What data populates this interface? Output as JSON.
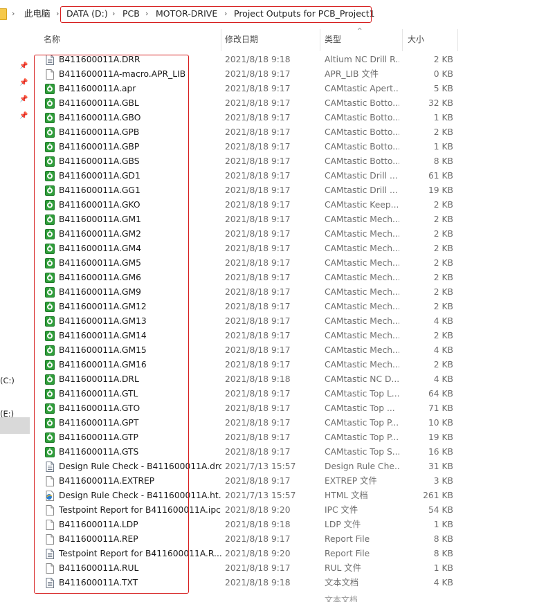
{
  "breadcrumb": {
    "items": [
      "此电脑",
      "DATA (D:)",
      "PCB",
      "MOTOR-DRIVE",
      "Project Outputs for PCB_Project1"
    ]
  },
  "left_pane": {
    "drives": [
      "(C:)",
      "(E:)"
    ]
  },
  "columns": {
    "name": "名称",
    "date": "修改日期",
    "type": "类型",
    "size": "大小"
  },
  "files": [
    {
      "name": "B411600011A.DRR",
      "date": "2021/8/18 9:18",
      "type": "Altium NC Drill R...",
      "size": "2 KB",
      "icon": "text-file-icon"
    },
    {
      "name": "B411600011A-macro.APR_LIB",
      "date": "2021/8/18 9:17",
      "type": "APR_LIB 文件",
      "size": "0 KB",
      "icon": "blank-file-icon"
    },
    {
      "name": "B411600011A.apr",
      "date": "2021/8/18 9:17",
      "type": "CAMtastic Apert...",
      "size": "5 KB",
      "icon": "camtastic-icon"
    },
    {
      "name": "B411600011A.GBL",
      "date": "2021/8/18 9:17",
      "type": "CAMtastic Botto...",
      "size": "32 KB",
      "icon": "camtastic-icon"
    },
    {
      "name": "B411600011A.GBO",
      "date": "2021/8/18 9:17",
      "type": "CAMtastic Botto...",
      "size": "1 KB",
      "icon": "camtastic-icon"
    },
    {
      "name": "B411600011A.GPB",
      "date": "2021/8/18 9:17",
      "type": "CAMtastic Botto...",
      "size": "2 KB",
      "icon": "camtastic-icon"
    },
    {
      "name": "B411600011A.GBP",
      "date": "2021/8/18 9:17",
      "type": "CAMtastic Botto...",
      "size": "1 KB",
      "icon": "camtastic-icon"
    },
    {
      "name": "B411600011A.GBS",
      "date": "2021/8/18 9:17",
      "type": "CAMtastic Botto...",
      "size": "8 KB",
      "icon": "camtastic-icon"
    },
    {
      "name": "B411600011A.GD1",
      "date": "2021/8/18 9:17",
      "type": "CAMtastic Drill ...",
      "size": "61 KB",
      "icon": "camtastic-icon"
    },
    {
      "name": "B411600011A.GG1",
      "date": "2021/8/18 9:17",
      "type": "CAMtastic Drill ...",
      "size": "19 KB",
      "icon": "camtastic-icon"
    },
    {
      "name": "B411600011A.GKO",
      "date": "2021/8/18 9:17",
      "type": "CAMtastic Keep...",
      "size": "2 KB",
      "icon": "camtastic-icon"
    },
    {
      "name": "B411600011A.GM1",
      "date": "2021/8/18 9:17",
      "type": "CAMtastic Mech...",
      "size": "2 KB",
      "icon": "camtastic-icon"
    },
    {
      "name": "B411600011A.GM2",
      "date": "2021/8/18 9:17",
      "type": "CAMtastic Mech...",
      "size": "2 KB",
      "icon": "camtastic-icon"
    },
    {
      "name": "B411600011A.GM4",
      "date": "2021/8/18 9:17",
      "type": "CAMtastic Mech...",
      "size": "2 KB",
      "icon": "camtastic-icon"
    },
    {
      "name": "B411600011A.GM5",
      "date": "2021/8/18 9:17",
      "type": "CAMtastic Mech...",
      "size": "2 KB",
      "icon": "camtastic-icon"
    },
    {
      "name": "B411600011A.GM6",
      "date": "2021/8/18 9:17",
      "type": "CAMtastic Mech...",
      "size": "2 KB",
      "icon": "camtastic-icon"
    },
    {
      "name": "B411600011A.GM9",
      "date": "2021/8/18 9:17",
      "type": "CAMtastic Mech...",
      "size": "2 KB",
      "icon": "camtastic-icon"
    },
    {
      "name": "B411600011A.GM12",
      "date": "2021/8/18 9:17",
      "type": "CAMtastic Mech...",
      "size": "2 KB",
      "icon": "camtastic-icon"
    },
    {
      "name": "B411600011A.GM13",
      "date": "2021/8/18 9:17",
      "type": "CAMtastic Mech...",
      "size": "4 KB",
      "icon": "camtastic-icon"
    },
    {
      "name": "B411600011A.GM14",
      "date": "2021/8/18 9:17",
      "type": "CAMtastic Mech...",
      "size": "2 KB",
      "icon": "camtastic-icon"
    },
    {
      "name": "B411600011A.GM15",
      "date": "2021/8/18 9:17",
      "type": "CAMtastic Mech...",
      "size": "4 KB",
      "icon": "camtastic-icon"
    },
    {
      "name": "B411600011A.GM16",
      "date": "2021/8/18 9:17",
      "type": "CAMtastic Mech...",
      "size": "2 KB",
      "icon": "camtastic-icon"
    },
    {
      "name": "B411600011A.DRL",
      "date": "2021/8/18 9:18",
      "type": "CAMtastic NC D...",
      "size": "4 KB",
      "icon": "camtastic-icon"
    },
    {
      "name": "B411600011A.GTL",
      "date": "2021/8/18 9:17",
      "type": "CAMtastic Top L...",
      "size": "64 KB",
      "icon": "camtastic-icon"
    },
    {
      "name": "B411600011A.GTO",
      "date": "2021/8/18 9:17",
      "type": "CAMtastic Top ...",
      "size": "71 KB",
      "icon": "camtastic-icon"
    },
    {
      "name": "B411600011A.GPT",
      "date": "2021/8/18 9:17",
      "type": "CAMtastic Top P...",
      "size": "10 KB",
      "icon": "camtastic-icon"
    },
    {
      "name": "B411600011A.GTP",
      "date": "2021/8/18 9:17",
      "type": "CAMtastic Top P...",
      "size": "19 KB",
      "icon": "camtastic-icon"
    },
    {
      "name": "B411600011A.GTS",
      "date": "2021/8/18 9:17",
      "type": "CAMtastic Top S...",
      "size": "16 KB",
      "icon": "camtastic-icon"
    },
    {
      "name": "Design Rule Check - B411600011A.drc",
      "date": "2021/7/13 15:57",
      "type": "Design Rule Che...",
      "size": "31 KB",
      "icon": "text-file-icon"
    },
    {
      "name": "B411600011A.EXTREP",
      "date": "2021/8/18 9:17",
      "type": "EXTREP 文件",
      "size": "3 KB",
      "icon": "blank-file-icon"
    },
    {
      "name": "Design Rule Check - B411600011A.ht...",
      "date": "2021/7/13 15:57",
      "type": "HTML 文档",
      "size": "261 KB",
      "icon": "html-file-icon"
    },
    {
      "name": "Testpoint Report for B411600011A.ipc",
      "date": "2021/8/18 9:20",
      "type": "IPC 文件",
      "size": "54 KB",
      "icon": "blank-file-icon"
    },
    {
      "name": "B411600011A.LDP",
      "date": "2021/8/18 9:18",
      "type": "LDP 文件",
      "size": "1 KB",
      "icon": "blank-file-icon"
    },
    {
      "name": "B411600011A.REP",
      "date": "2021/8/18 9:17",
      "type": "Report File",
      "size": "8 KB",
      "icon": "blank-file-icon"
    },
    {
      "name": "Testpoint Report for B411600011A.R...",
      "date": "2021/8/18 9:20",
      "type": "Report File",
      "size": "8 KB",
      "icon": "text-file-icon"
    },
    {
      "name": "B411600011A.RUL",
      "date": "2021/8/18 9:17",
      "type": "RUL 文件",
      "size": "1 KB",
      "icon": "blank-file-icon"
    },
    {
      "name": "B411600011A.TXT",
      "date": "2021/8/18 9:18",
      "type": "文本文档",
      "size": "4 KB",
      "icon": "text-file-icon"
    }
  ],
  "partial_row": {
    "type": "文本文档"
  },
  "colors": {
    "highlight_border": "#d61e1e",
    "camtastic_green": "#2f9e3a",
    "selected_drive": "#d9d9d9"
  }
}
